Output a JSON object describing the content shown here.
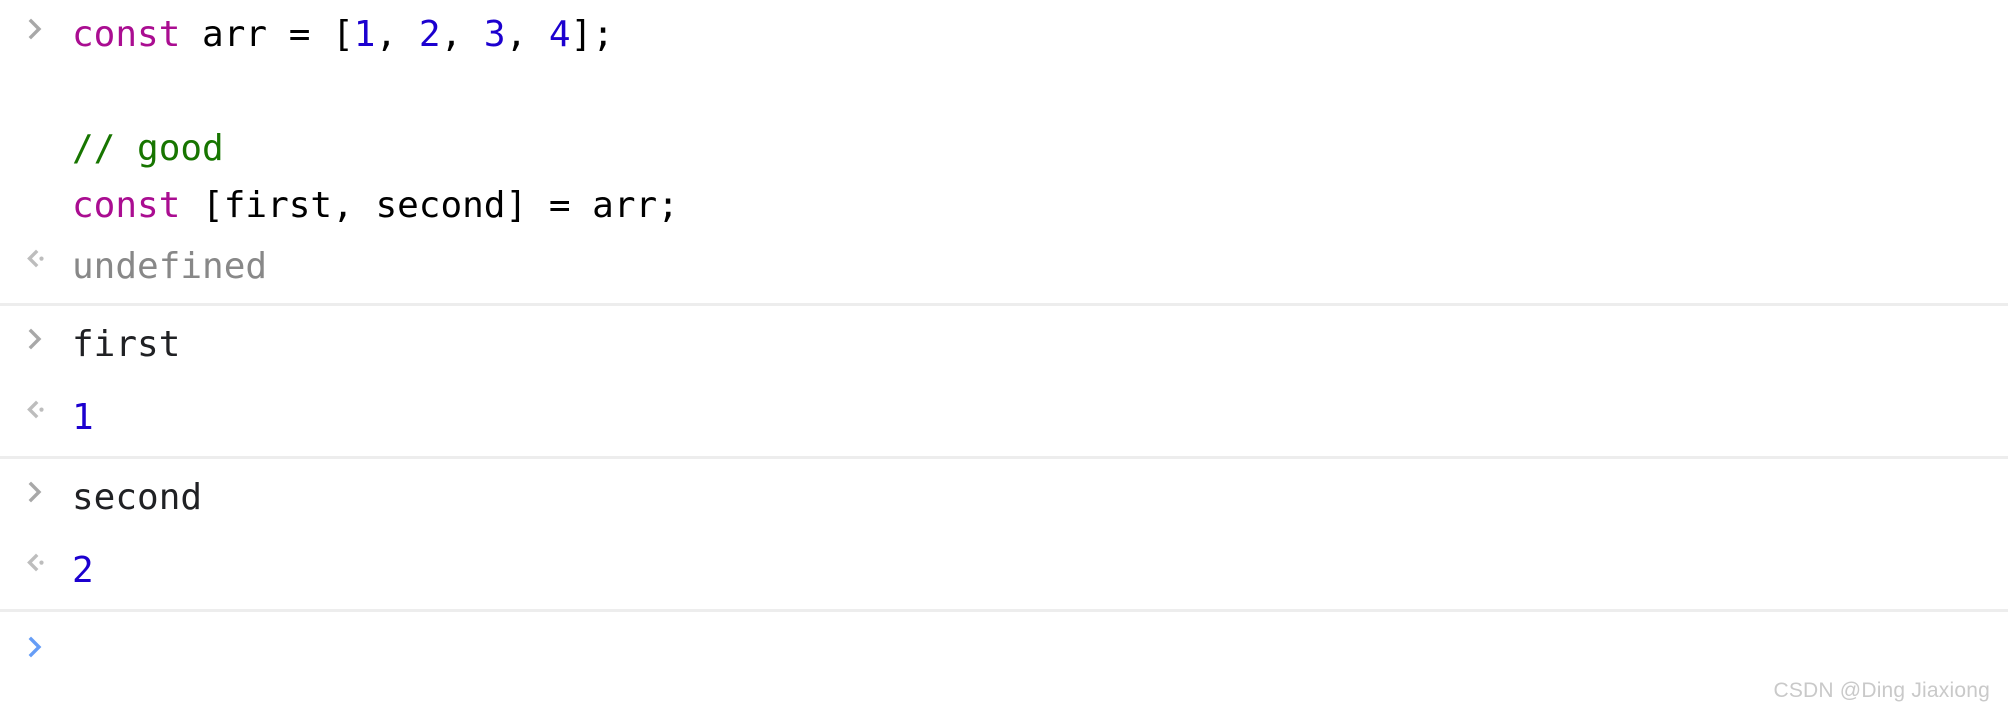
{
  "app": {
    "name": "Chrome DevTools Console",
    "theme": "light",
    "background_color": "#ffffff",
    "divider_color": "#ededed"
  },
  "colors": {
    "keyword": "#aa0d91",
    "number": "#1c00cf",
    "comment": "#177500",
    "plain_text": "#000000",
    "undefined_result": "#888888",
    "prompt_inactive": "#a8a8a8",
    "prompt_active": "#669df6",
    "watermark": "#c9c9c9"
  },
  "icons": {
    "input_chevron": "chevron-right-icon",
    "output_chevron": "chevron-left-dot-icon"
  },
  "entries": [
    {
      "id": "entry-1",
      "type": "input",
      "icon": "chevron-right-icon",
      "lines": [
        {
          "tokens": [
            {
              "text": "const",
              "kind": "keyword"
            },
            {
              "text": " arr = [",
              "kind": "plain"
            },
            {
              "text": "1",
              "kind": "number"
            },
            {
              "text": ", ",
              "kind": "plain"
            },
            {
              "text": "2",
              "kind": "number"
            },
            {
              "text": ", ",
              "kind": "plain"
            },
            {
              "text": "3",
              "kind": "number"
            },
            {
              "text": ", ",
              "kind": "plain"
            },
            {
              "text": "4",
              "kind": "number"
            },
            {
              "text": "];",
              "kind": "plain"
            }
          ],
          "plain": "const arr = [1, 2, 3, 4];"
        },
        {
          "tokens": [],
          "plain": ""
        },
        {
          "tokens": [
            {
              "text": "// good",
              "kind": "comment"
            }
          ],
          "plain": "// good"
        },
        {
          "tokens": [
            {
              "text": "const",
              "kind": "keyword"
            },
            {
              "text": " [first, second] = arr;",
              "kind": "plain"
            }
          ],
          "plain": "const [first, second] = arr;"
        }
      ]
    },
    {
      "id": "result-1",
      "type": "output",
      "icon": "chevron-left-dot-icon",
      "value": "undefined",
      "value_kind": "undefined"
    },
    {
      "id": "entry-2",
      "type": "input",
      "icon": "chevron-right-icon",
      "expression": "first"
    },
    {
      "id": "result-2",
      "type": "output",
      "icon": "chevron-left-dot-icon",
      "value": "1",
      "value_kind": "number"
    },
    {
      "id": "entry-3",
      "type": "input",
      "icon": "chevron-right-icon",
      "expression": "second"
    },
    {
      "id": "result-3",
      "type": "output",
      "icon": "chevron-left-dot-icon",
      "value": "2",
      "value_kind": "number"
    }
  ],
  "prompt": {
    "icon": "chevron-right-icon",
    "value": "",
    "placeholder": ""
  },
  "watermark": {
    "text": "CSDN @Ding Jiaxiong"
  }
}
